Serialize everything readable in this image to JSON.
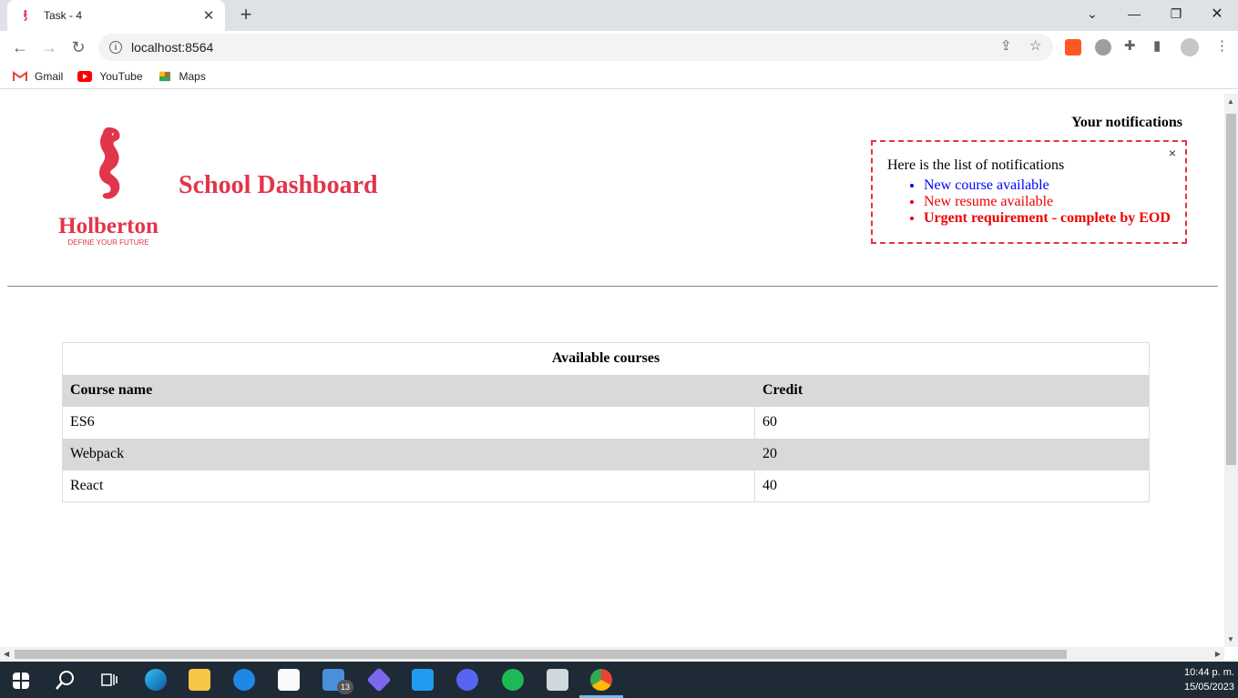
{
  "browser": {
    "tab_title": "Task - 4",
    "tab_close": "✕",
    "new_tab": "+",
    "url": "localhost:8564",
    "bookmarks": [
      {
        "label": "Gmail",
        "icon": "gmail-icon"
      },
      {
        "label": "YouTube",
        "icon": "youtube-icon"
      },
      {
        "label": "Maps",
        "icon": "maps-icon"
      }
    ]
  },
  "header": {
    "logo_text": "Holberton",
    "logo_tagline": "DEFINE YOUR FUTURE",
    "title": "School Dashboard"
  },
  "notifications": {
    "heading": "Your notifications",
    "close": "×",
    "intro": "Here is the list of notifications",
    "items": [
      {
        "text": "New course available",
        "priority": "default"
      },
      {
        "text": "New resume available",
        "priority": "urgent"
      },
      {
        "text": "Urgent requirement - complete by EOD",
        "priority": "urgent-html"
      }
    ]
  },
  "courses": {
    "caption": "Available courses",
    "headers": [
      "Course name",
      "Credit"
    ],
    "rows": [
      [
        "ES6",
        "60"
      ],
      [
        "Webpack",
        "20"
      ],
      [
        "React",
        "40"
      ]
    ]
  },
  "taskbar": {
    "time": "10:44 p. m.",
    "date": "15/05/2023",
    "mail_badge": "13"
  },
  "colors": {
    "brand": "#e1354b",
    "notif_default": "#0000ff",
    "notif_urgent": "#ee0000"
  }
}
